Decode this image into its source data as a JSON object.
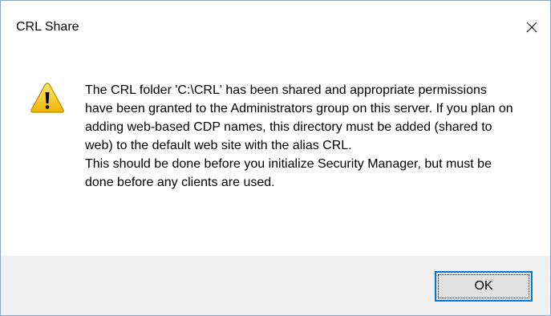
{
  "window": {
    "title": "CRL Share",
    "close_icon": "close-icon"
  },
  "message": {
    "icon": "warning-icon",
    "paragraph1": "The CRL folder 'C:\\CRL' has been shared and appropriate permissions have been granted to the Administrators group on this server. If you plan on adding web-based CDP names, this directory must be added (shared to web) to the default web site with the alias CRL.",
    "paragraph2": "This should be done before you initialize Security Manager, but must be done before any clients are used."
  },
  "buttons": {
    "ok_label": "OK"
  },
  "colors": {
    "accent": "#0078d7",
    "footer_bg": "#f0f0f0",
    "button_bg": "#e1e1e1",
    "warning_yellow": "#f7c52b"
  }
}
